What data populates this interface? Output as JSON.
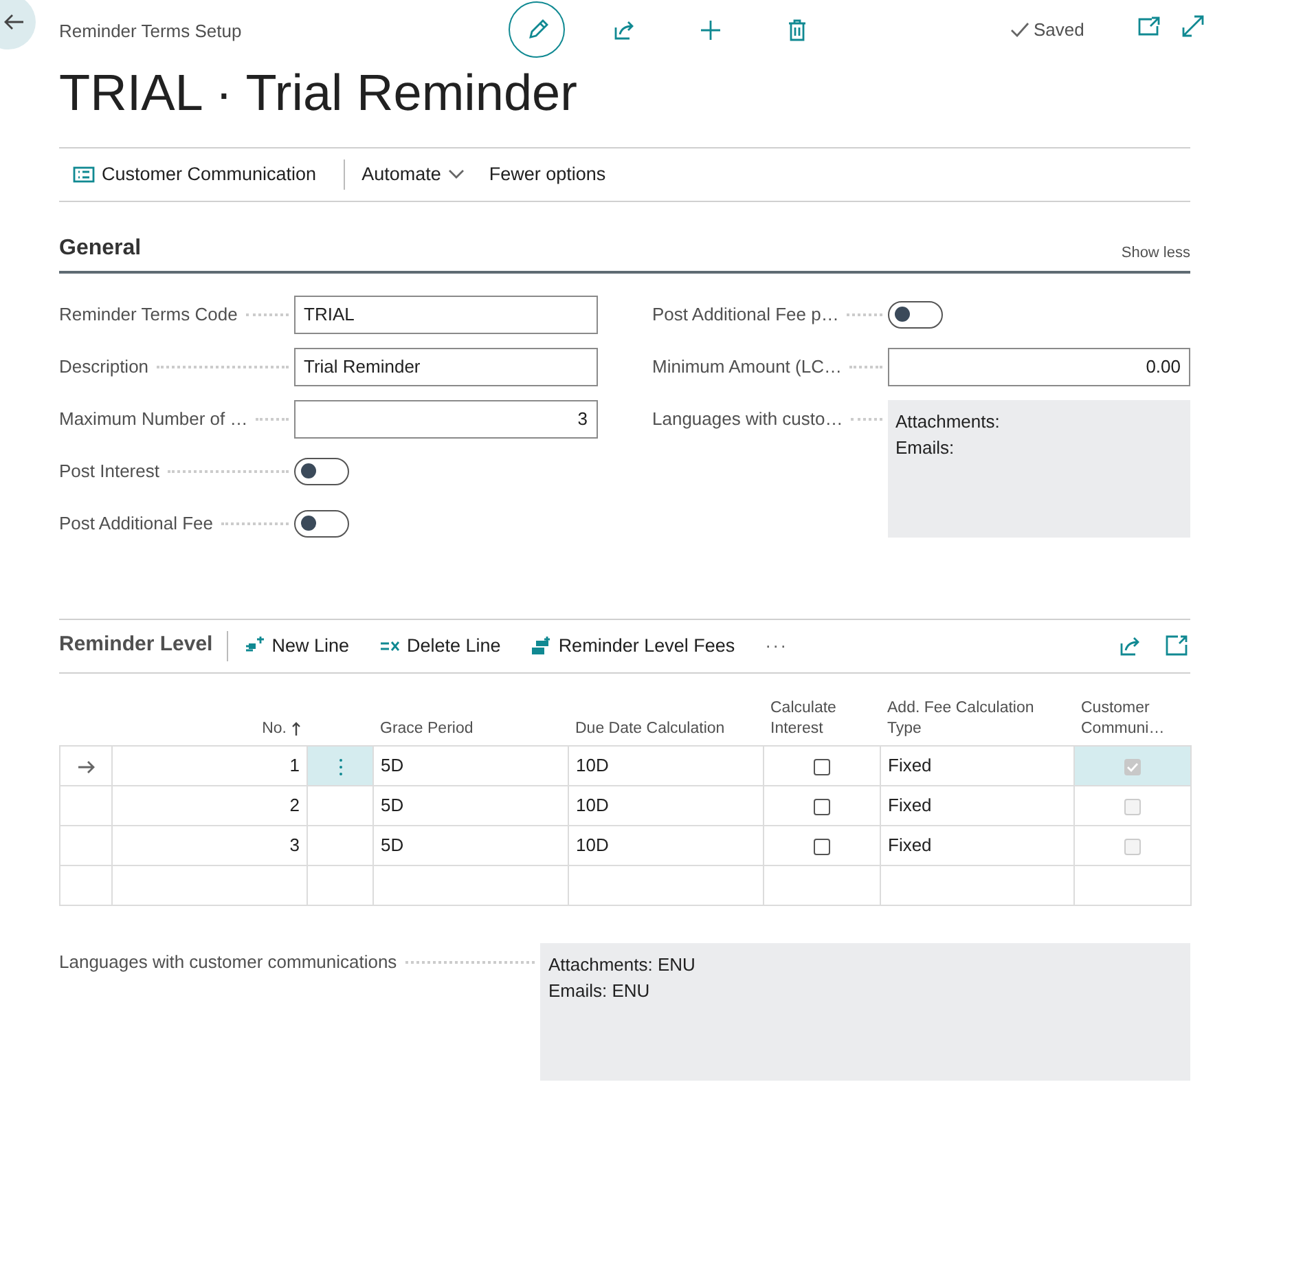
{
  "header": {
    "breadcrumb": "Reminder Terms Setup",
    "status": "Saved",
    "title": "TRIAL · Trial Reminder"
  },
  "actions": [
    {
      "label": "Customer Communication",
      "kind": "icon"
    },
    {
      "label": "Automate",
      "kind": "dropdown"
    },
    {
      "label": "Fewer options",
      "kind": "plain"
    }
  ],
  "general": {
    "title": "General",
    "toggle_label": "Show less",
    "left_fields": [
      {
        "label": "Reminder Terms Code",
        "kind": "text",
        "value": "TRIAL"
      },
      {
        "label": "Description",
        "kind": "text",
        "value": "Trial Reminder"
      },
      {
        "label": "Maximum Number of …",
        "kind": "number",
        "value": "3"
      },
      {
        "label": "Post Interest",
        "kind": "toggle",
        "on": false
      },
      {
        "label": "Post Additional Fee",
        "kind": "toggle",
        "on": false
      }
    ],
    "right_fields": [
      {
        "label": "Post Additional Fee p…",
        "kind": "toggle",
        "on": false
      },
      {
        "label": "Minimum Amount (LC…",
        "kind": "number",
        "value": "0.00"
      },
      {
        "label": "Languages with custo…",
        "kind": "note",
        "lines": [
          "Attachments:",
          "Emails:"
        ]
      }
    ]
  },
  "lines": {
    "title": "Reminder Level",
    "actions": [
      {
        "label": "New Line",
        "kind": "new"
      },
      {
        "label": "Delete Line",
        "kind": "delete"
      },
      {
        "label": "Reminder Level Fees",
        "kind": "fees"
      },
      {
        "label": "···",
        "kind": "more"
      }
    ],
    "columns": [
      {
        "label": "No.",
        "kind": "number",
        "sorted": true
      },
      {
        "label": "Grace Period",
        "kind": "text"
      },
      {
        "label": "Due Date Calculation",
        "kind": "text"
      },
      {
        "label": "Calculate Interest",
        "kind": "check"
      },
      {
        "label": "Add. Fee Calculation Type",
        "kind": "text"
      },
      {
        "label": "Customer Communi…",
        "kind": "readonly_check"
      }
    ],
    "rows": [
      {
        "kind": "line",
        "selected": true,
        "cells": [
          "1",
          "5D",
          "10D",
          false,
          "Fixed",
          true
        ]
      },
      {
        "kind": "line",
        "selected": false,
        "cells": [
          "2",
          "5D",
          "10D",
          false,
          "Fixed",
          false
        ]
      },
      {
        "kind": "line",
        "selected": false,
        "cells": [
          "3",
          "5D",
          "10D",
          false,
          "Fixed",
          false
        ]
      },
      {
        "kind": "blank",
        "selected": false
      }
    ]
  },
  "footer_field": {
    "label": "Languages with customer communications",
    "kind": "note",
    "lines": [
      "Attachments: ENU",
      "Emails: ENU"
    ]
  }
}
